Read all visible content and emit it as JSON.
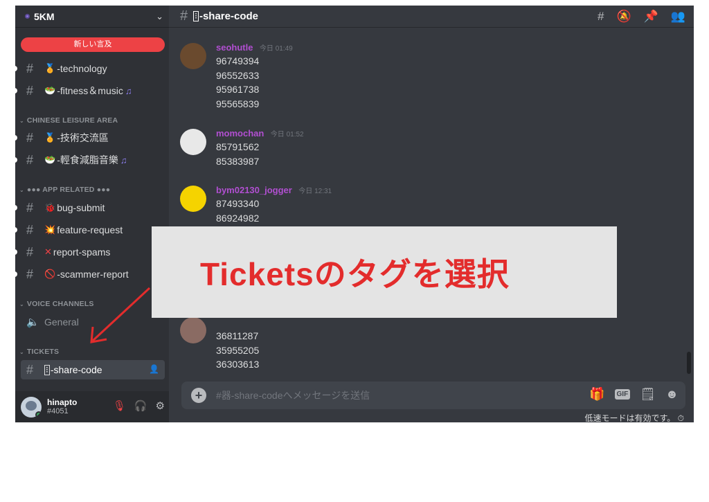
{
  "server": {
    "name": "5KM",
    "chevron": "chevron-down-icon"
  },
  "mention_pill": "新しい言及",
  "categories": {
    "chinese": "CHINESE LEISURE AREA",
    "app": "●●● APP RELATED ●●●",
    "voice": "VOICE CHANNELS",
    "tickets": "TICKETS"
  },
  "channels": {
    "technology": "-technology",
    "fitness": "-fitness＆music",
    "tech_cn": "-技術交流區",
    "fitness_cn": "-輕食減脂音樂",
    "bug": "bug-submit",
    "feature": "feature-request",
    "spams": "report-spams",
    "scammer": "-scammer-report",
    "general": "General",
    "share": "-share-code"
  },
  "user": {
    "name": "hinapto",
    "tag": "#4051"
  },
  "header": {
    "title": "-share-code"
  },
  "messages": [
    {
      "author": "seohutle",
      "time": "今日 01:49",
      "lines": [
        "96749394",
        "96552633",
        "95961738",
        "95565839"
      ]
    },
    {
      "author": "momochan",
      "time": "今日 01:52",
      "lines": [
        "85791562",
        "85383987"
      ]
    },
    {
      "author": "bym02130_jogger",
      "time": "今日 12:31",
      "lines": [
        "87493340",
        "86924982"
      ]
    },
    {
      "author": "",
      "time": "",
      "lines": [
        "36811287",
        "35955205",
        "36303613"
      ]
    }
  ],
  "composer": {
    "placeholder": "#器-share-codeへメッセージを送信"
  },
  "slowmode": "低速モードは有効です。",
  "overlay": {
    "caption": "Ticketsのタグを選択"
  },
  "colors": {
    "accent": "#e32c2c",
    "author": "#b14fd1",
    "mention": "#ed4245"
  }
}
